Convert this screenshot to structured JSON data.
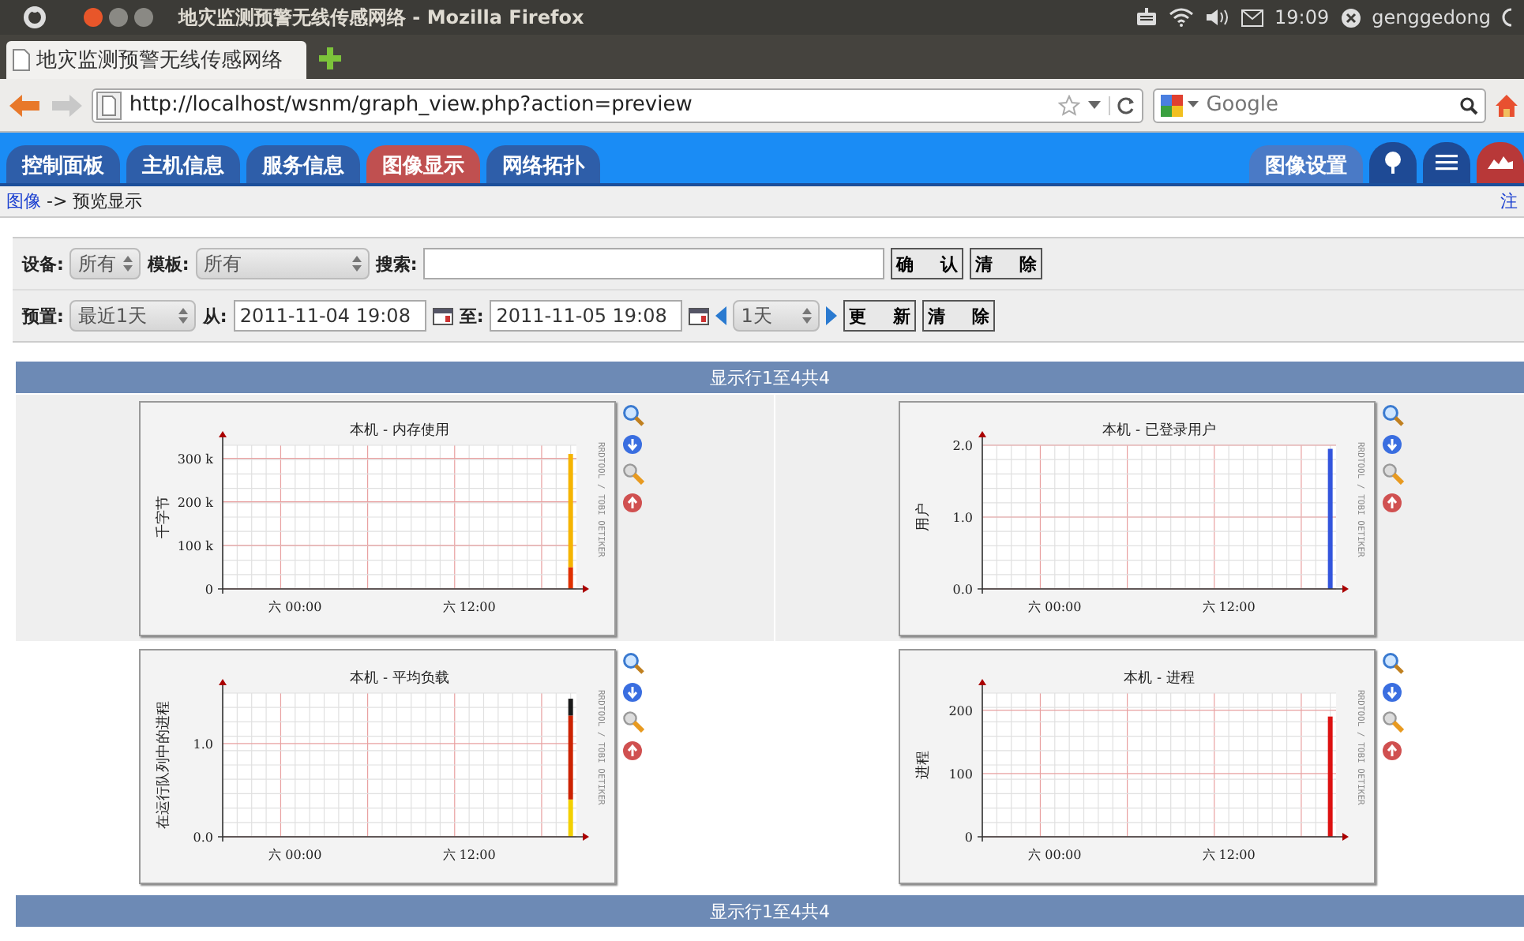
{
  "system_bar": {
    "title": "地灾监测预警无线传感网络 - Mozilla Firefox",
    "time": "19:09",
    "user": "genggedong"
  },
  "browser": {
    "tab": "地灾监测预警无线传感网络",
    "url": "http://localhost/wsnm/graph_view.php?action=preview",
    "search": {
      "placeholder": "Google"
    }
  },
  "nav_tabs": [
    {
      "label": "控制面板",
      "selected": false
    },
    {
      "label": "主机信息",
      "selected": false
    },
    {
      "label": "服务信息",
      "selected": false
    },
    {
      "label": "图像显示",
      "selected": true
    },
    {
      "label": "网络拓扑",
      "selected": false
    }
  ],
  "settings_tab": "图像设置",
  "icon_tabs": [
    {
      "kind": "tree",
      "selected": false
    },
    {
      "kind": "list",
      "selected": false
    },
    {
      "kind": "graph",
      "selected": true
    }
  ],
  "breadcrumb": {
    "link": "图像",
    "rest": "-> 预览显示",
    "logout": "注"
  },
  "filter_row1": {
    "device_label": "设备:",
    "device": "所有",
    "template_label": "模板:",
    "template": "所有",
    "search_label": "搜索:",
    "buttons": [
      "确 认",
      "清 除"
    ]
  },
  "filter_row2": {
    "preset_label": "预置:",
    "preset": "最近1天",
    "from_label": "从:",
    "from": "2011-11-04 19:08",
    "to_label": "至:",
    "to": "2011-11-05 19:08",
    "step": "1天",
    "buttons": [
      "更 新",
      "清 除"
    ]
  },
  "pager_top": "显示行1至4共4",
  "graphs": [
    {
      "credit": "RRDTOOL / TOBI OETIKER",
      "chart_data": {
        "type": "bar",
        "stacked": true,
        "grid": true,
        "title": "本机 - 内存使用",
        "ylabel": "千字节",
        "categories": [
          null,
          null,
          null,
          null,
          null,
          "六 00:00",
          null,
          null,
          null,
          null,
          null,
          null,
          null,
          null,
          null,
          null,
          null,
          "六 12:00",
          null,
          null,
          null,
          null,
          null,
          null,
          null
        ],
        "ylim": [
          0,
          330000
        ],
        "yticks": [
          {
            "value": 0,
            "label": "0"
          },
          {
            "value": 100000,
            "label": "100 k"
          },
          {
            "value": 200000,
            "label": "200 k"
          },
          {
            "value": 300000,
            "label": "300 k"
          }
        ],
        "series": [
          {
            "color": "#e03000",
            "values": [
              null,
              null,
              null,
              null,
              null,
              null,
              null,
              null,
              null,
              null,
              null,
              null,
              null,
              null,
              null,
              null,
              null,
              null,
              null,
              null,
              null,
              null,
              null,
              null,
              50000
            ]
          },
          {
            "color": "#f5b400",
            "values": [
              null,
              null,
              null,
              null,
              null,
              null,
              null,
              null,
              null,
              null,
              null,
              null,
              null,
              null,
              null,
              null,
              null,
              null,
              null,
              null,
              null,
              null,
              null,
              null,
              260000
            ]
          }
        ]
      }
    },
    {
      "credit": "RRDTOOL / TOBI OETIKER",
      "chart_data": {
        "type": "bar",
        "stacked": true,
        "grid": true,
        "title": "本机 - 已登录用户",
        "ylabel": "用户",
        "categories": [
          null,
          null,
          null,
          null,
          null,
          "六 00:00",
          null,
          null,
          null,
          null,
          null,
          null,
          null,
          null,
          null,
          null,
          null,
          "六 12:00",
          null,
          null,
          null,
          null,
          null,
          null,
          null
        ],
        "ylim": [
          0,
          2
        ],
        "yticks": [
          {
            "value": 0,
            "label": "0.0"
          },
          {
            "value": 1,
            "label": "1.0"
          },
          {
            "value": 2,
            "label": "2.0"
          }
        ],
        "series": [
          {
            "color": "#3355dd",
            "values": [
              null,
              null,
              null,
              null,
              null,
              null,
              null,
              null,
              null,
              null,
              null,
              null,
              null,
              null,
              null,
              null,
              null,
              null,
              null,
              null,
              null,
              null,
              null,
              null,
              1.95
            ]
          }
        ]
      }
    },
    {
      "credit": "RRDTOOL / TOBI OETIKER",
      "chart_data": {
        "type": "bar",
        "stacked": true,
        "grid": true,
        "title": "本机 - 平均负载",
        "ylabel": "在运行队列中的进程",
        "categories": [
          null,
          null,
          null,
          null,
          null,
          "六 00:00",
          null,
          null,
          null,
          null,
          null,
          null,
          null,
          null,
          null,
          null,
          null,
          "六 12:00",
          null,
          null,
          null,
          null,
          null,
          null,
          null
        ],
        "ylim": [
          0,
          1.54
        ],
        "yticks": [
          {
            "value": 0,
            "label": "0.0"
          },
          {
            "value": 1,
            "label": "1.0"
          }
        ],
        "series": [
          {
            "color": "#f2d000",
            "values": [
              null,
              null,
              null,
              null,
              null,
              null,
              null,
              null,
              null,
              null,
              null,
              null,
              null,
              null,
              null,
              null,
              null,
              null,
              null,
              null,
              null,
              null,
              null,
              null,
              0.4
            ]
          },
          {
            "color": "#cc2200",
            "values": [
              null,
              null,
              null,
              null,
              null,
              null,
              null,
              null,
              null,
              null,
              null,
              null,
              null,
              null,
              null,
              null,
              null,
              null,
              null,
              null,
              null,
              null,
              null,
              null,
              0.9
            ]
          },
          {
            "color": "#1a1a1a",
            "values": [
              null,
              null,
              null,
              null,
              null,
              null,
              null,
              null,
              null,
              null,
              null,
              null,
              null,
              null,
              null,
              null,
              null,
              null,
              null,
              null,
              null,
              null,
              null,
              null,
              0.18
            ]
          }
        ]
      }
    },
    {
      "credit": "RRDTOOL / TOBI OETIKER",
      "chart_data": {
        "type": "bar",
        "stacked": true,
        "grid": true,
        "title": "本机 - 进程",
        "ylabel": "进程",
        "categories": [
          null,
          null,
          null,
          null,
          null,
          "六 00:00",
          null,
          null,
          null,
          null,
          null,
          null,
          null,
          null,
          null,
          null,
          null,
          "六 12:00",
          null,
          null,
          null,
          null,
          null,
          null,
          null
        ],
        "ylim": [
          0,
          227
        ],
        "yticks": [
          {
            "value": 0,
            "label": "0"
          },
          {
            "value": 100,
            "label": "100"
          },
          {
            "value": 200,
            "label": "200"
          }
        ],
        "series": [
          {
            "color": "#dd1111",
            "values": [
              null,
              null,
              null,
              null,
              null,
              null,
              null,
              null,
              null,
              null,
              null,
              null,
              null,
              null,
              null,
              null,
              null,
              null,
              null,
              null,
              null,
              null,
              null,
              null,
              190
            ]
          }
        ]
      }
    }
  ],
  "pager_bottom": "显示行1至4共4"
}
